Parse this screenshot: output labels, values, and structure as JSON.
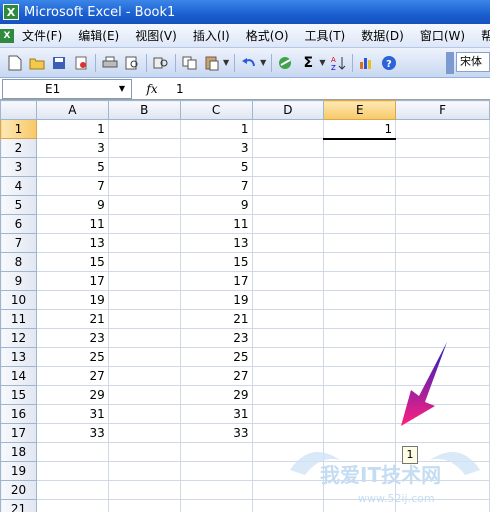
{
  "window": {
    "title": "Microsoft Excel - Book1",
    "app_icon": "X"
  },
  "menu": {
    "items": [
      "文件(F)",
      "编辑(E)",
      "视图(V)",
      "插入(I)",
      "格式(O)",
      "工具(T)",
      "数据(D)",
      "窗口(W)",
      "帮"
    ]
  },
  "toolbar": {
    "font_name": "宋体"
  },
  "formula_bar": {
    "name_box": "E1",
    "fx_label": "fx",
    "formula": "1"
  },
  "sheet": {
    "columns": [
      "A",
      "B",
      "C",
      "D",
      "E",
      "F"
    ],
    "rows": [
      {
        "n": "1",
        "A": "1",
        "C": "1",
        "E": "1"
      },
      {
        "n": "2",
        "A": "3",
        "C": "3",
        "E": ""
      },
      {
        "n": "3",
        "A": "5",
        "C": "5",
        "E": ""
      },
      {
        "n": "4",
        "A": "7",
        "C": "7",
        "E": ""
      },
      {
        "n": "5",
        "A": "9",
        "C": "9",
        "E": ""
      },
      {
        "n": "6",
        "A": "11",
        "C": "11",
        "E": ""
      },
      {
        "n": "7",
        "A": "13",
        "C": "13",
        "E": ""
      },
      {
        "n": "8",
        "A": "15",
        "C": "15",
        "E": ""
      },
      {
        "n": "9",
        "A": "17",
        "C": "17",
        "E": ""
      },
      {
        "n": "10",
        "A": "19",
        "C": "19",
        "E": ""
      },
      {
        "n": "11",
        "A": "21",
        "C": "21",
        "E": ""
      },
      {
        "n": "12",
        "A": "23",
        "C": "23",
        "E": ""
      },
      {
        "n": "13",
        "A": "25",
        "C": "25",
        "E": ""
      },
      {
        "n": "14",
        "A": "27",
        "C": "27",
        "E": ""
      },
      {
        "n": "15",
        "A": "29",
        "C": "29",
        "E": ""
      },
      {
        "n": "16",
        "A": "31",
        "C": "31",
        "E": ""
      },
      {
        "n": "17",
        "A": "33",
        "C": "33",
        "E": ""
      },
      {
        "n": "18",
        "A": "",
        "C": "",
        "E": ""
      },
      {
        "n": "19",
        "A": "",
        "C": "",
        "E": ""
      },
      {
        "n": "20",
        "A": "",
        "C": "",
        "E": ""
      },
      {
        "n": "21",
        "A": "",
        "C": "",
        "E": ""
      }
    ]
  },
  "fill_tooltip": "1",
  "watermark": {
    "text": "我爱IT技术网",
    "url": "www.52ij.com"
  },
  "colors": {
    "title_bar": "#1a5fd0",
    "active_header": "#f8c867",
    "arrow_top": "#2020c0",
    "arrow_bottom": "#ff2080"
  }
}
